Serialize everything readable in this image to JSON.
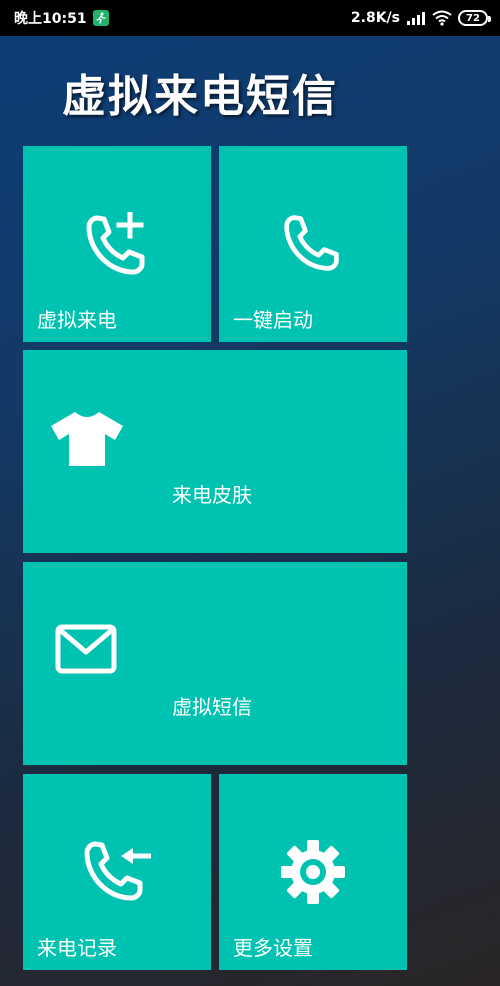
{
  "status_bar": {
    "time": "晚上10:51",
    "network_speed": "2.8K/s",
    "battery": "72",
    "icons": [
      "run-icon",
      "signal-icon",
      "wifi-icon",
      "battery-icon"
    ]
  },
  "app": {
    "title": "虚拟来电短信"
  },
  "tiles": [
    {
      "label": "虚拟来电",
      "icon": "phone-add-icon"
    },
    {
      "label": "一键启动",
      "icon": "phone-icon"
    },
    {
      "label": "来电皮肤",
      "icon": "tshirt-icon"
    },
    {
      "label": "虚拟短信",
      "icon": "envelope-icon"
    },
    {
      "label": "来电记录",
      "icon": "phone-incoming-icon"
    },
    {
      "label": "更多设置",
      "icon": "gear-icon"
    }
  ],
  "colors": {
    "tile": "#00c2b0",
    "statusbar": "#000000",
    "background_top": "#0d3d78",
    "background_bottom": "#2a2626"
  }
}
